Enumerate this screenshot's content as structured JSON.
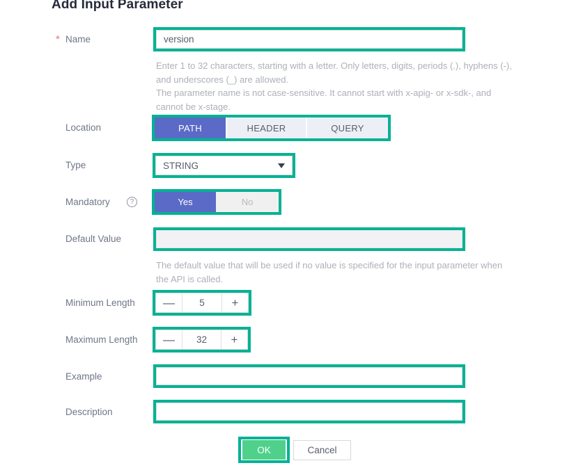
{
  "dialog": {
    "title": "Add Input Parameter"
  },
  "fields": {
    "name": {
      "label": "Name",
      "required_marker": "*",
      "value": "version",
      "placeholder": "",
      "helper_lines": [
        "Enter 1 to 32 characters, starting with a letter. Only letters, digits, periods (.), hyphens (-),",
        "and underscores (_) are allowed.",
        "The parameter name is not case-sensitive. It cannot start with x-apig- or x-sdk-, and",
        "cannot be x-stage."
      ]
    },
    "location": {
      "label": "Location",
      "options": [
        "PATH",
        "HEADER",
        "QUERY"
      ],
      "selected": "PATH"
    },
    "type": {
      "label": "Type",
      "selected": "STRING"
    },
    "mandatory": {
      "label": "Mandatory",
      "help_icon": "question-mark-icon",
      "help_glyph": "?",
      "options": [
        "Yes",
        "No"
      ],
      "selected": "Yes"
    },
    "default_value": {
      "label": "Default Value",
      "value": "",
      "disabled": true,
      "helper_lines": [
        "The default value that will be used if no value is specified for the input parameter when",
        "the API is called."
      ]
    },
    "minimum_length": {
      "label": "Minimum Length",
      "value": "5",
      "decrement": "—",
      "increment": "+"
    },
    "maximum_length": {
      "label": "Maximum Length",
      "value": "32",
      "decrement": "—",
      "increment": "+"
    },
    "example": {
      "label": "Example",
      "value": ""
    },
    "description": {
      "label": "Description",
      "value": ""
    }
  },
  "footer": {
    "ok_label": "OK",
    "cancel_label": "Cancel"
  },
  "colors": {
    "highlight_ring": "#04b294",
    "accent_purple": "#5b6ac6",
    "ok_green": "#4fd18b",
    "required_red": "#f07070",
    "label_gray": "#6e7687",
    "helper_gray": "#adb0b8",
    "title_navy": "#252b3a"
  }
}
